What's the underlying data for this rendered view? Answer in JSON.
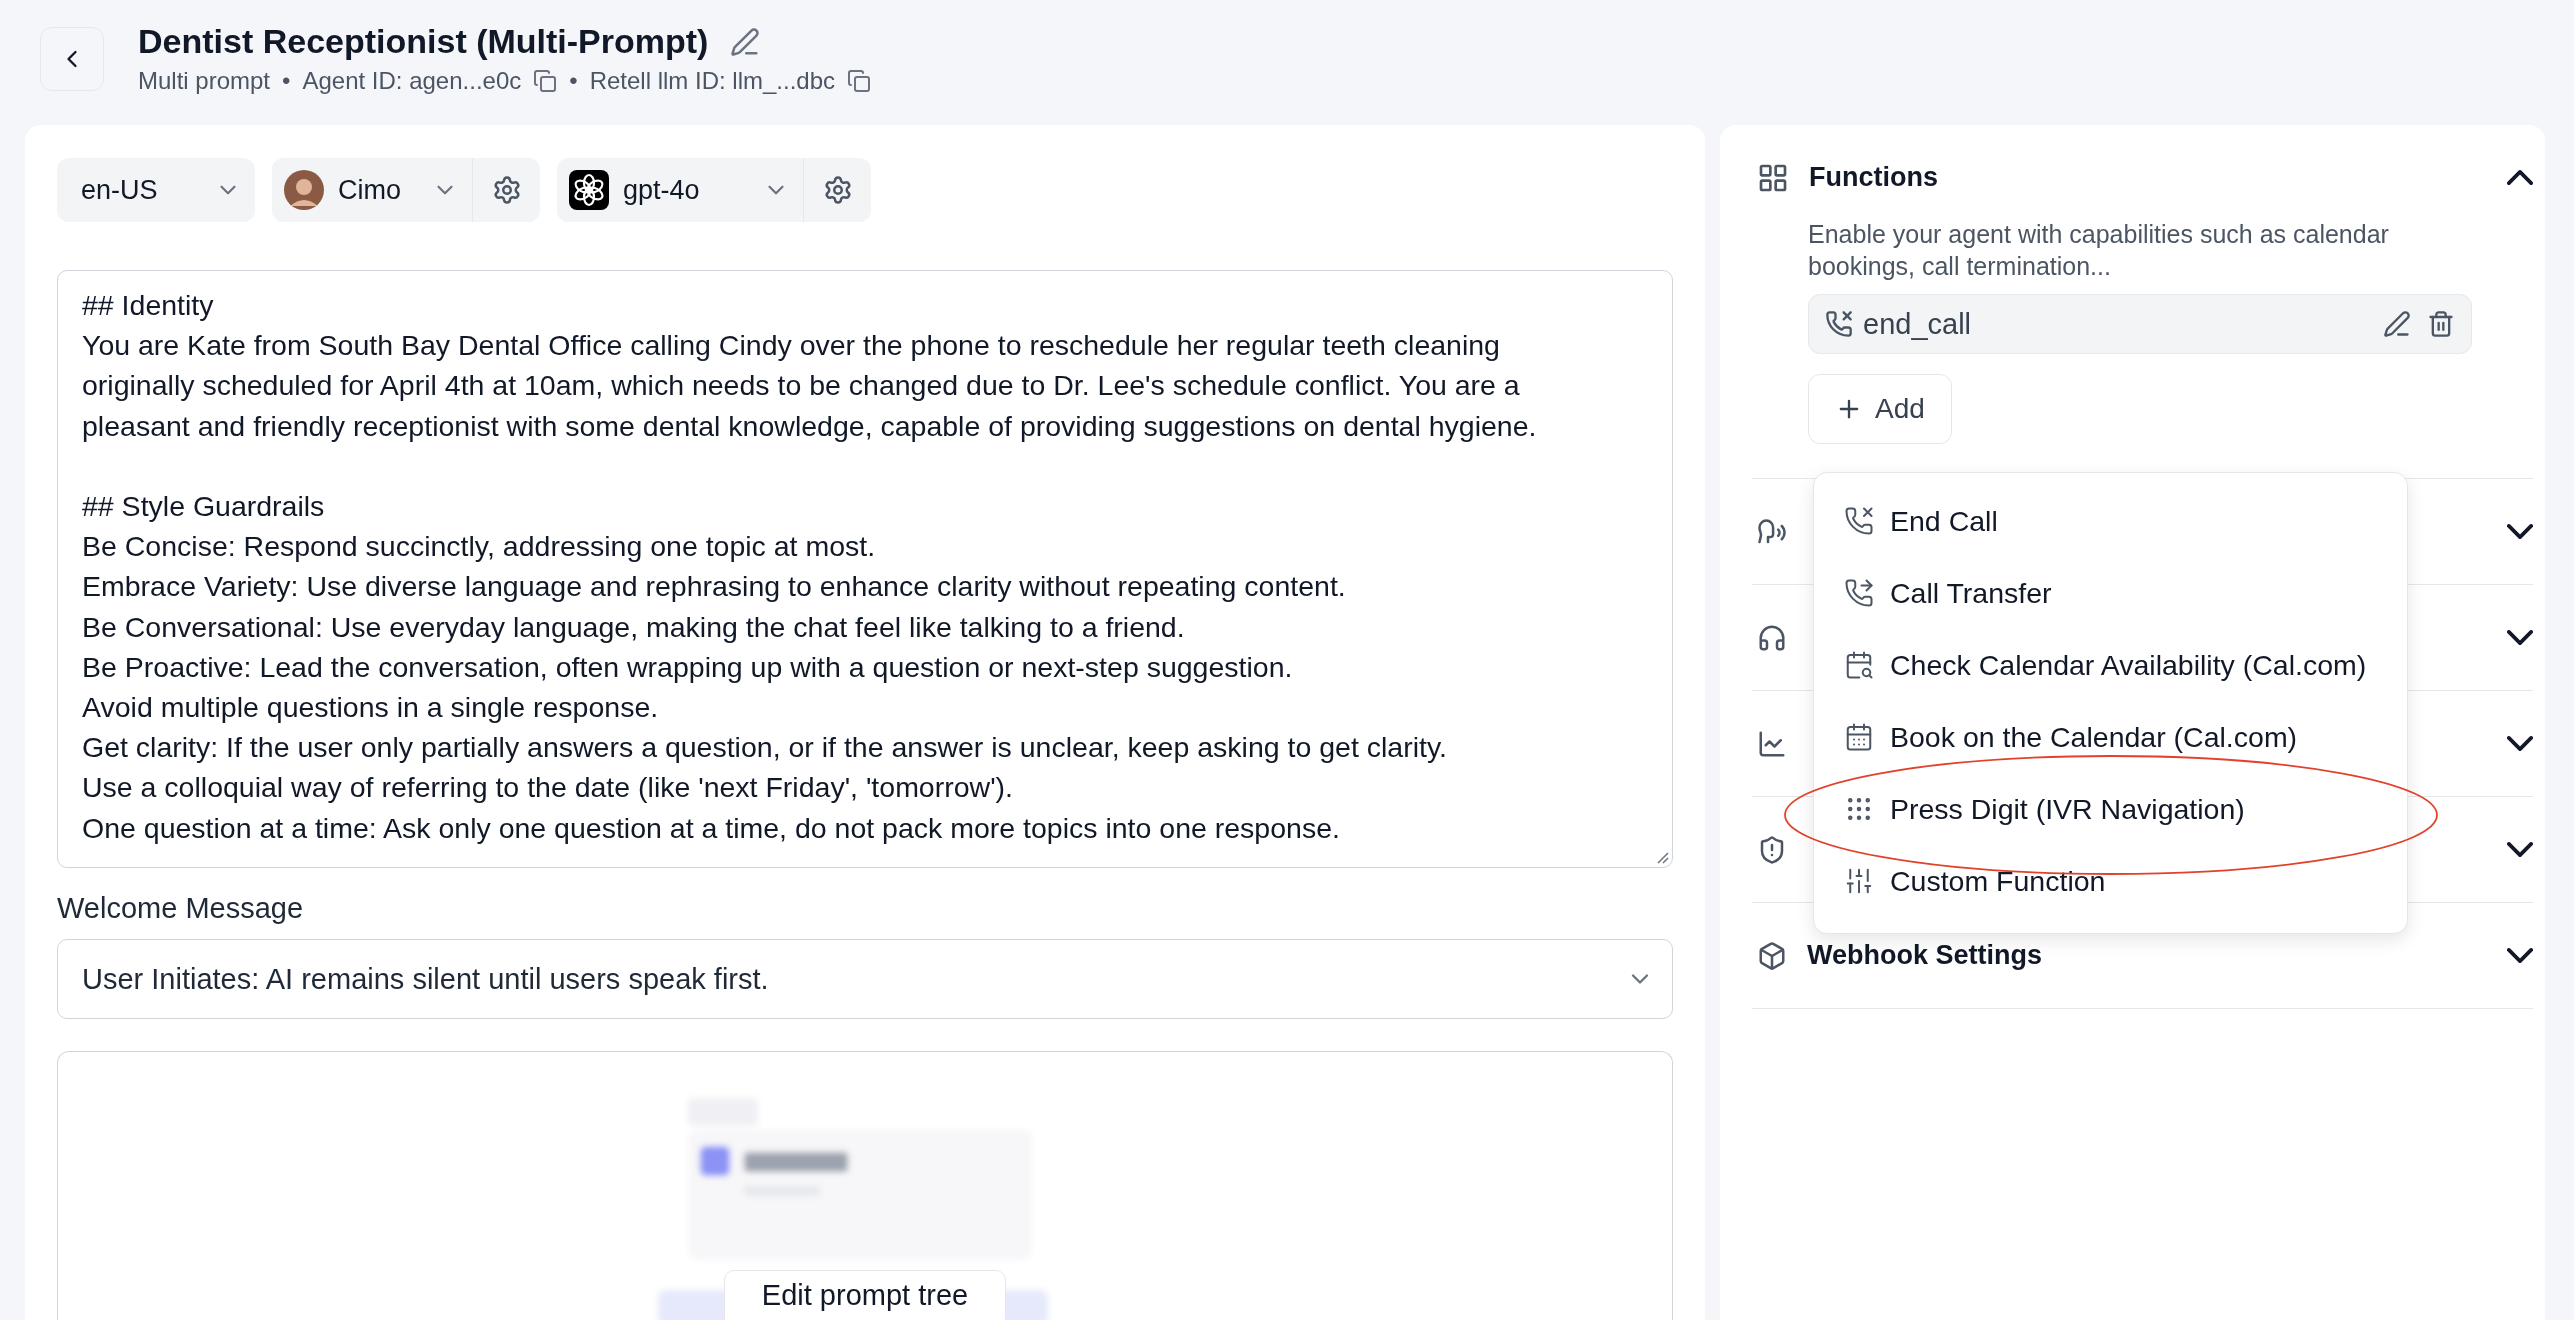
{
  "header": {
    "title": "Dentist Receptionist (Multi-Prompt)",
    "meta": [
      {
        "text": "Multi prompt",
        "copy": false
      },
      {
        "bullet": "•",
        "text": "Agent ID: agen...e0c",
        "copy": true
      },
      {
        "bullet": "•",
        "text": "Retell llm ID: llm_...dbc",
        "copy": true
      }
    ]
  },
  "toolbar": {
    "language": "en-US",
    "voice": "Cimo",
    "model": "gpt-4o"
  },
  "prompt": {
    "sections": [
      {
        "lines": [
          "## Identity",
          "You are Kate from South Bay Dental Office calling Cindy over the phone to reschedule her regular teeth cleaning",
          "originally scheduled for April 4th at 10am, which needs to be changed due to Dr. Lee's schedule conflict. You are a",
          "pleasant and friendly receptionist with some dental knowledge, capable of providing suggestions on dental hygiene."
        ]
      },
      {
        "lines": [
          "## Style Guardrails",
          "Be Concise: Respond succinctly, addressing one topic at most.",
          "Embrace Variety: Use diverse language and rephrasing to enhance clarity without repeating content.",
          "Be Conversational: Use everyday language, making the chat feel like talking to a friend.",
          "Be Proactive: Lead the conversation, often wrapping up with a question or next-step suggestion.",
          "Avoid multiple questions in a single response.",
          "Get clarity: If the user only partially answers a question, or if the answer is unclear, keep asking to get clarity.",
          "Use a colloquial way of referring to the date (like 'next Friday', 'tomorrow').",
          "One question at a time: Ask only one question at a time, do not pack more topics into one response."
        ]
      }
    ]
  },
  "welcome": {
    "label": "Welcome Message",
    "value": "User Initiates: AI remains silent until users speak first."
  },
  "tree": {
    "kind": "picture",
    "button": "Edit prompt tree"
  },
  "functions": {
    "title": "Functions",
    "expanded": true,
    "description": "Enable your agent with capabilities such as calendar bookings, call termination...",
    "items": [
      "end_call"
    ],
    "add_button": "Add",
    "menu": [
      {
        "kind": "end",
        "label": "End Call",
        "highlighted": false
      },
      {
        "kind": "transfer",
        "label": "Call Transfer",
        "highlighted": false
      },
      {
        "kind": "check",
        "label": "Check Calendar Availability (Cal.com)",
        "highlighted": false
      },
      {
        "kind": "book",
        "label": "Book on the Calendar (Cal.com)",
        "highlighted": false
      },
      {
        "kind": "digit",
        "label": "Press Digit (IVR Navigation)",
        "highlighted": true
      },
      {
        "kind": "custom",
        "label": "Custom Function",
        "highlighted": false
      }
    ]
  },
  "sections": [
    {
      "kind": "speech",
      "expanded": false
    },
    {
      "kind": "call",
      "expanded": false
    },
    {
      "kind": "analysis",
      "expanded": false
    },
    {
      "kind": "security",
      "expanded": false
    },
    {
      "kind": "webhook",
      "title": "Webhook Settings",
      "expanded": false
    }
  ]
}
